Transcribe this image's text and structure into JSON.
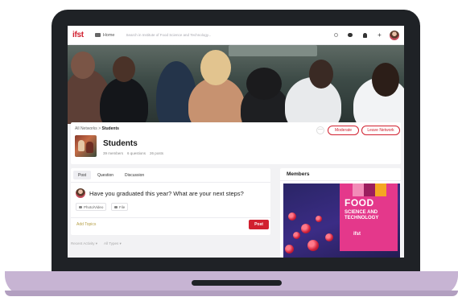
{
  "nav": {
    "logo": "ifst",
    "home_label": "Home",
    "search_placeholder": "Search in Institute of Food Science and Technology..."
  },
  "header": {
    "breadcrumb_root": "All Networks",
    "breadcrumb_sep": ">",
    "breadcrumb_current": "Students",
    "group_title": "Students",
    "stats": [
      "39 members",
      "6 questions",
      "26 posts"
    ],
    "more_label": "···",
    "moderate_label": "Moderate",
    "leave_label": "Leave Network"
  },
  "composer": {
    "tabs": [
      "Post",
      "Question",
      "Discussion"
    ],
    "active_tab": "Post",
    "question_text": "Have you graduated this year? What are your next steps?",
    "photo_label": "Photo/Video",
    "file_label": "File",
    "add_topics_label": "Add Topics",
    "post_label": "Post"
  },
  "filters": {
    "activity_label": "Recent Activity",
    "types_label": "All Types"
  },
  "members": {
    "title": "Members",
    "promo_title": "FOOD",
    "promo_subtitle": "SCIENCE AND TECHNOLOGY",
    "promo_logo": "ifst"
  },
  "colors": {
    "brand": "#d1202f",
    "promo_bg": "#2a2566",
    "promo_pink": "#e4388b",
    "laptop_body": "#1f2226",
    "laptop_base": "#c7b4d3"
  }
}
